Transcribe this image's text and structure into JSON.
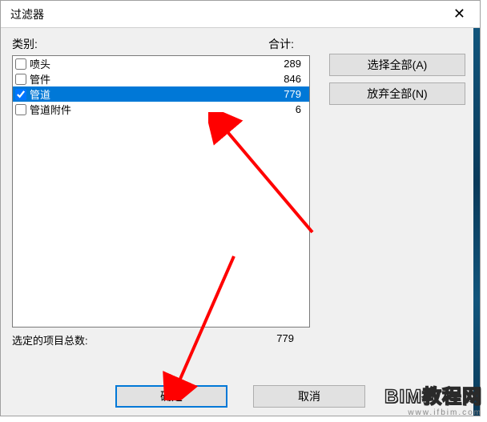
{
  "dialog": {
    "title": "过滤器"
  },
  "headers": {
    "category": "类别:",
    "total": "合计:"
  },
  "items": [
    {
      "label": "喷头",
      "count": "289",
      "checked": false,
      "selected": false
    },
    {
      "label": "管件",
      "count": "846",
      "checked": false,
      "selected": false
    },
    {
      "label": "管道",
      "count": "779",
      "checked": true,
      "selected": true
    },
    {
      "label": "管道附件",
      "count": "6",
      "checked": false,
      "selected": false
    }
  ],
  "side_buttons": {
    "select_all": "选择全部(A)",
    "discard_all": "放弃全部(N)"
  },
  "footer": {
    "label": "选定的项目总数:",
    "value": "779"
  },
  "bottom_buttons": {
    "ok": "确定",
    "cancel": "取消"
  },
  "watermark": {
    "main": "BIM教程网",
    "sub": "www.ifbim.com"
  }
}
